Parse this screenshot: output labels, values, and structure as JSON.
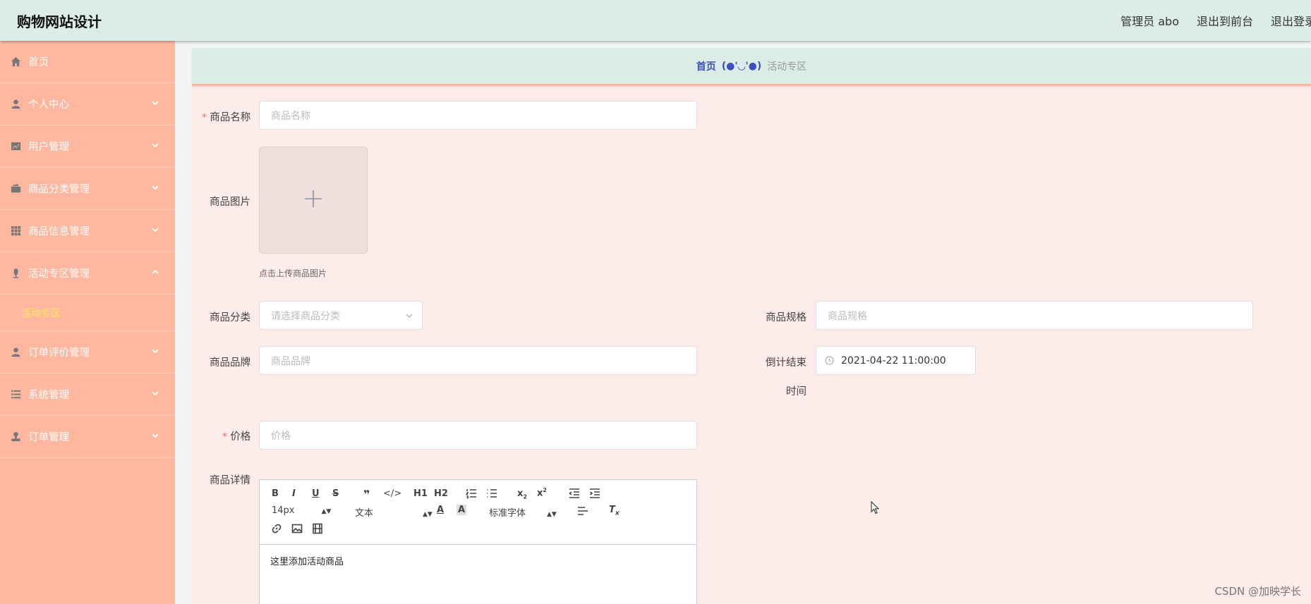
{
  "header": {
    "title": "购物网站设计",
    "admin_label": "管理员 abo",
    "front_link": "退出到前台",
    "logout_link": "退出登录"
  },
  "sidebar": {
    "items": [
      {
        "label": "首页",
        "icon": "home-icon"
      },
      {
        "label": "个人中心",
        "icon": "user-icon"
      },
      {
        "label": "用户管理",
        "icon": "chart-icon"
      },
      {
        "label": "商品分类管理",
        "icon": "wallet-icon"
      },
      {
        "label": "商品信息管理",
        "icon": "grid-icon"
      },
      {
        "label": "活动专区管理",
        "icon": "microphone-icon"
      },
      {
        "label": "订单评价管理",
        "icon": "user-icon"
      },
      {
        "label": "系统管理",
        "icon": "list-icon"
      },
      {
        "label": "订单管理",
        "icon": "stamp-icon"
      }
    ],
    "active_sub": "活动专区"
  },
  "breadcrumb": {
    "home": "首页",
    "separator": "(●'◡'●)",
    "current": "活动专区"
  },
  "form": {
    "name_label": "商品名称",
    "name_placeholder": "商品名称",
    "image_label": "商品图片",
    "image_tip": "点击上传商品图片",
    "category_label": "商品分类",
    "category_placeholder": "请选择商品分类",
    "spec_label": "商品规格",
    "spec_placeholder": "商品规格",
    "brand_label": "商品品牌",
    "brand_placeholder": "商品品牌",
    "countdown_label_1": "倒计结束",
    "countdown_label_2": "时间",
    "countdown_value": "2021-04-22 11:00:00",
    "price_label": "价格",
    "price_placeholder": "价格",
    "detail_label": "商品详情"
  },
  "editor": {
    "font_size": "14px",
    "header_select": "文本",
    "font_select": "标准字体",
    "content": "这里添加活动商品"
  },
  "watermark": "CSDN @加映学长",
  "colors": {
    "header_bg": "#dcece6",
    "sidebar_bg": "#ffb79f",
    "content_bg": "#fdecea",
    "active_sub": "#ffea5c",
    "breadcrumb_home": "#3d4fc2"
  }
}
